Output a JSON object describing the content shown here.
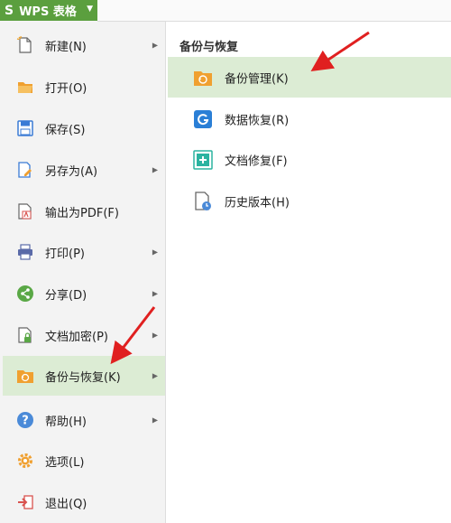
{
  "app_button": {
    "logo": "S",
    "label": "WPS 表格",
    "caret": "▼"
  },
  "left_menu": {
    "items": [
      {
        "label": "新建(N)",
        "icon": "new-file-icon",
        "has_arrow": true
      },
      {
        "label": "打开(O)",
        "icon": "folder-open-icon",
        "has_arrow": false
      },
      {
        "label": "保存(S)",
        "icon": "save-icon",
        "has_arrow": false
      },
      {
        "label": "另存为(A)",
        "icon": "save-as-icon",
        "has_arrow": true
      },
      {
        "label": "输出为PDF(F)",
        "icon": "pdf-icon",
        "has_arrow": false
      },
      {
        "label": "打印(P)",
        "icon": "printer-icon",
        "has_arrow": true
      },
      {
        "label": "分享(D)",
        "icon": "share-icon",
        "has_arrow": true
      },
      {
        "label": "文档加密(P)",
        "icon": "encrypt-icon",
        "has_arrow": true
      },
      {
        "label": "备份与恢复(K)",
        "icon": "backup-icon",
        "has_arrow": true,
        "selected": true
      },
      {
        "label": "帮助(H)",
        "icon": "help-icon",
        "has_arrow": true
      },
      {
        "label": "选项(L)",
        "icon": "gear-icon",
        "has_arrow": false
      },
      {
        "label": "退出(Q)",
        "icon": "exit-icon",
        "has_arrow": false
      }
    ]
  },
  "right_panel": {
    "title": "备份与恢复",
    "items": [
      {
        "label": "备份管理(K)",
        "icon": "backup-manage-icon",
        "selected": true
      },
      {
        "label": "数据恢复(R)",
        "icon": "data-recovery-icon"
      },
      {
        "label": "文档修复(F)",
        "icon": "doc-repair-icon"
      },
      {
        "label": "历史版本(H)",
        "icon": "history-version-icon"
      }
    ]
  },
  "colors": {
    "brand_green": "#5b9f3e",
    "selected_bg": "#dcecd4",
    "annotation_red": "#e02020"
  }
}
